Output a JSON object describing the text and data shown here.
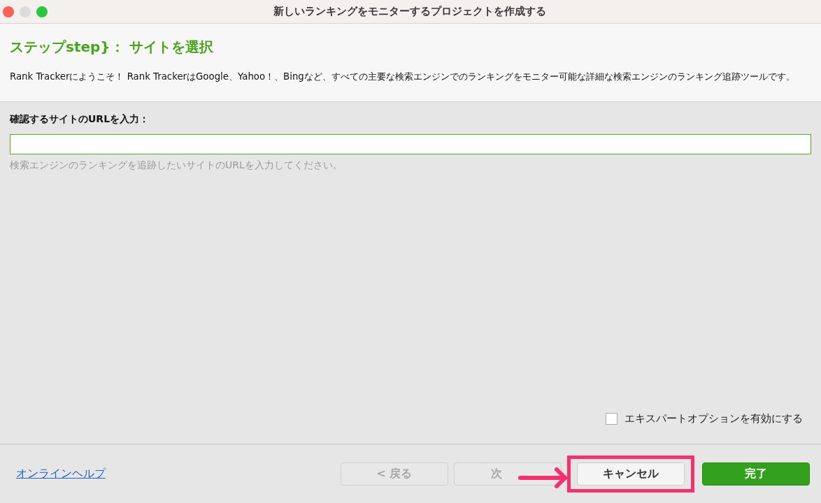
{
  "window": {
    "title": "新しいランキングをモニターするプロジェクトを作成する"
  },
  "header": {
    "step_title": "ステップstep}： サイトを選択",
    "description": "Rank Trackerにようこそ！ Rank TrackerはGoogle、Yahoo！、Bingなど、すべての主要な検索エンジンでのランキングをモニター可能な詳細な検索エンジンのランキング追跡ツールです。"
  },
  "url_field": {
    "label": "確認するサイトのURLを入力：",
    "hint": "検索エンジンのランキングを追跡したいサイトのURLを入力してください。",
    "focused": true
  },
  "expert_option": {
    "label": "エキスパートオプションを有効にする",
    "checked": false
  },
  "footer": {
    "help_link": "オンラインヘルプ",
    "buttons": [
      {
        "label": "< 戻る",
        "kind": "plain",
        "disabled": true,
        "highlighted": false
      },
      {
        "label": "次",
        "kind": "plain",
        "disabled": true,
        "highlighted": false
      },
      {
        "label": "キャンセル",
        "kind": "plain",
        "disabled": false,
        "highlighted": true
      },
      {
        "label": "完了",
        "kind": "primary",
        "disabled": false,
        "highlighted": false
      }
    ]
  }
}
